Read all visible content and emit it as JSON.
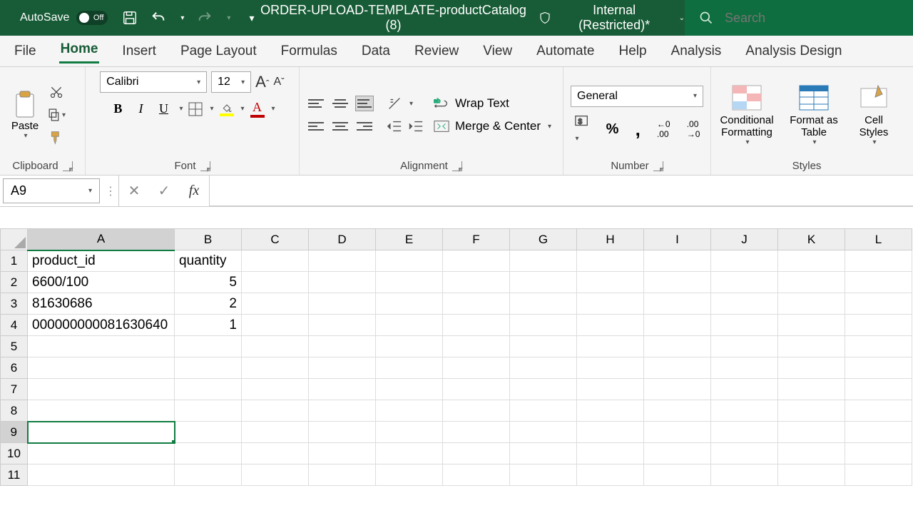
{
  "titlebar": {
    "autosave_label": "AutoSave",
    "autosave_state": "Off",
    "filename": "ORDER-UPLOAD-TEMPLATE-productCatalog (8)",
    "sensitivity": "Internal (Restricted)*",
    "search_placeholder": "Search"
  },
  "tabs": [
    "File",
    "Home",
    "Insert",
    "Page Layout",
    "Formulas",
    "Data",
    "Review",
    "View",
    "Automate",
    "Help",
    "Analysis",
    "Analysis Design"
  ],
  "active_tab": "Home",
  "ribbon": {
    "clipboard": {
      "label": "Clipboard",
      "paste": "Paste"
    },
    "font": {
      "label": "Font",
      "name": "Calibri",
      "size": "12"
    },
    "alignment": {
      "label": "Alignment",
      "wrap": "Wrap Text",
      "merge": "Merge & Center"
    },
    "number": {
      "label": "Number",
      "format": "General"
    },
    "styles": {
      "label": "Styles",
      "cond": "Conditional Formatting",
      "table": "Format as Table",
      "cell": "Cell Styles"
    }
  },
  "namebox": "A9",
  "columns": [
    "A",
    "B",
    "C",
    "D",
    "E",
    "F",
    "G",
    "H",
    "I",
    "J",
    "K",
    "L"
  ],
  "selected_col": "A",
  "selected_row": 9,
  "rows": [
    1,
    2,
    3,
    4,
    5,
    6,
    7,
    8,
    9,
    10,
    11
  ],
  "cells": {
    "A1": "product_id",
    "B1": "quantity",
    "A2": "6600/100",
    "B2": "5",
    "A3": "81630686",
    "B3": "2",
    "A4": "000000000081630640",
    "B4": "1"
  }
}
